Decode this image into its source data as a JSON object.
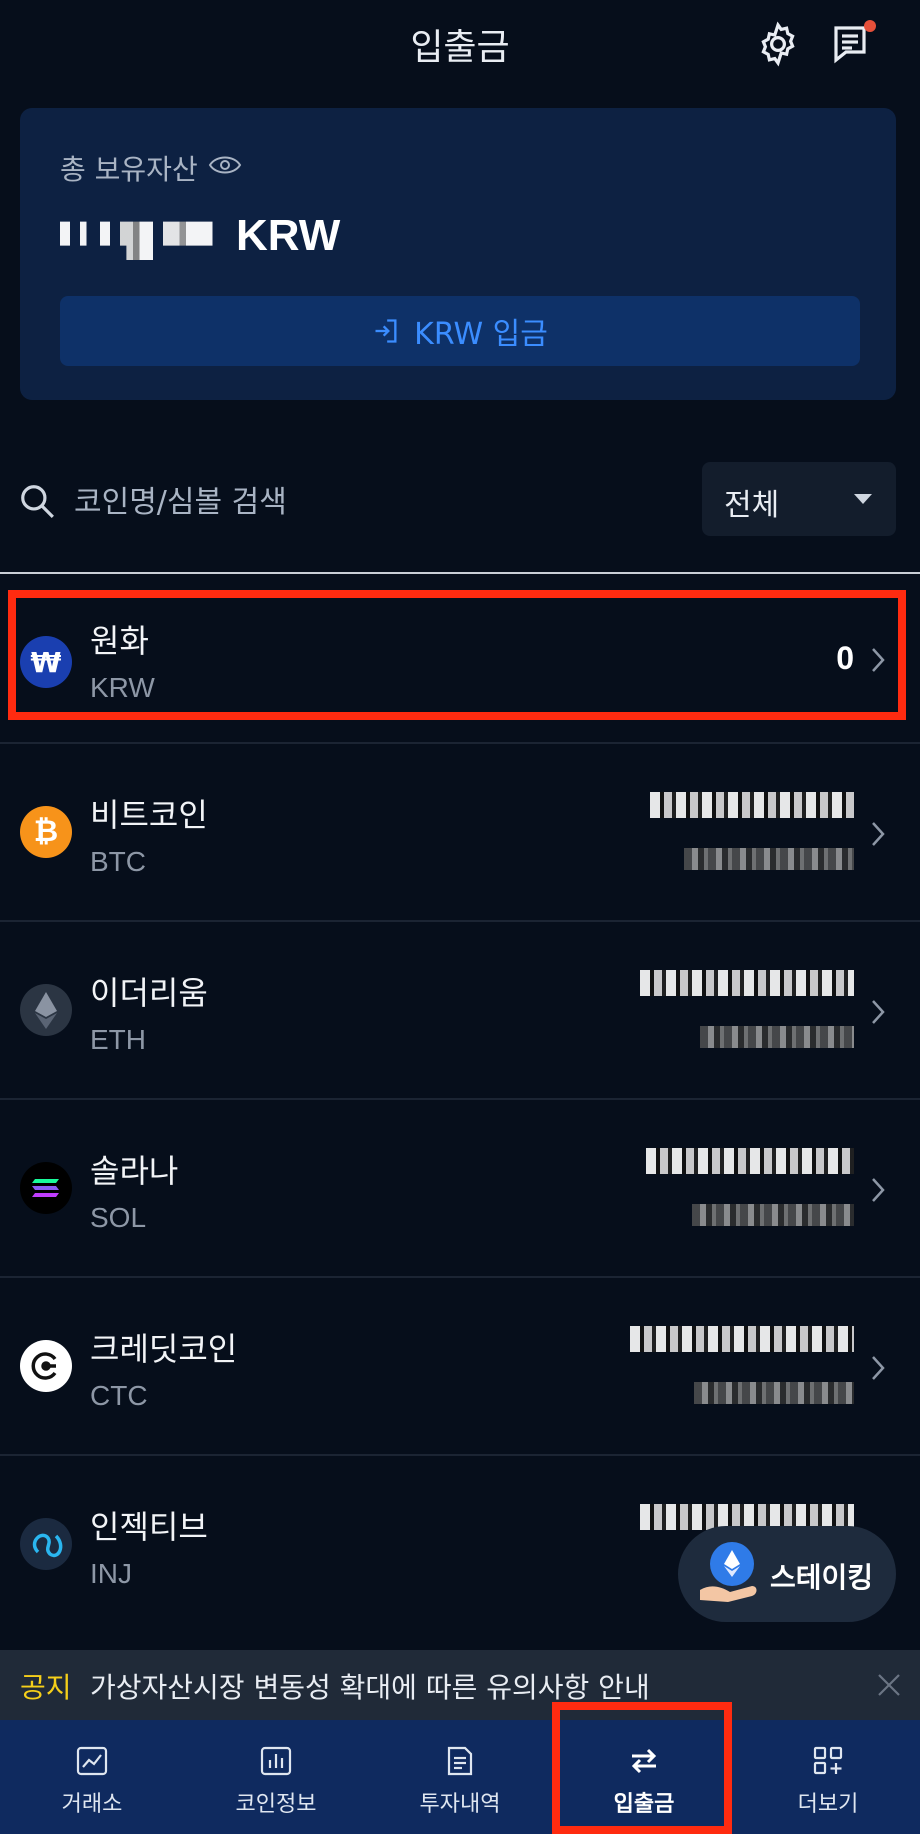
{
  "header": {
    "title": "입출금",
    "settings_icon": "gear-icon",
    "chat_icon": "chat-icon"
  },
  "asset": {
    "label": "총 보유자산",
    "unit": "KRW",
    "deposit_label": "KRW 입금"
  },
  "search": {
    "placeholder": "코인명/심볼 검색",
    "filter_label": "전체"
  },
  "coins": [
    {
      "name": "원화",
      "symbol": "KRW",
      "amount": "0",
      "icon": "won-icon",
      "color": "#1a3fb0"
    },
    {
      "name": "비트코인",
      "symbol": "BTC",
      "icon": "bitcoin-icon",
      "color": "#f7931a"
    },
    {
      "name": "이더리움",
      "symbol": "ETH",
      "icon": "ethereum-icon",
      "color": "#2b3543"
    },
    {
      "name": "솔라나",
      "symbol": "SOL",
      "icon": "solana-icon",
      "color": "#000000"
    },
    {
      "name": "크레딧코인",
      "symbol": "CTC",
      "icon": "creditcoin-icon",
      "color": "#ffffff"
    },
    {
      "name": "인젝티브",
      "symbol": "INJ",
      "icon": "injective-icon",
      "color": "#1b2a40"
    }
  ],
  "staking": {
    "label": "스테이킹"
  },
  "notice": {
    "tag": "공지",
    "text": "가상자산시장 변동성 확대에 따른 유의사항 안내"
  },
  "tabs": [
    {
      "label": "거래소",
      "icon": "chart-icon"
    },
    {
      "label": "코인정보",
      "icon": "bar-chart-icon"
    },
    {
      "label": "투자내역",
      "icon": "document-icon"
    },
    {
      "label": "입출금",
      "icon": "transfer-icon",
      "active": true
    },
    {
      "label": "더보기",
      "icon": "grid-plus-icon"
    }
  ],
  "colors": {
    "background": "#060e1b",
    "card": "#0d2142",
    "accent": "#3b8dff",
    "tabbar": "#0f2a5f",
    "highlight": "#ff2b10",
    "notice_tag": "#f5cf1a"
  }
}
